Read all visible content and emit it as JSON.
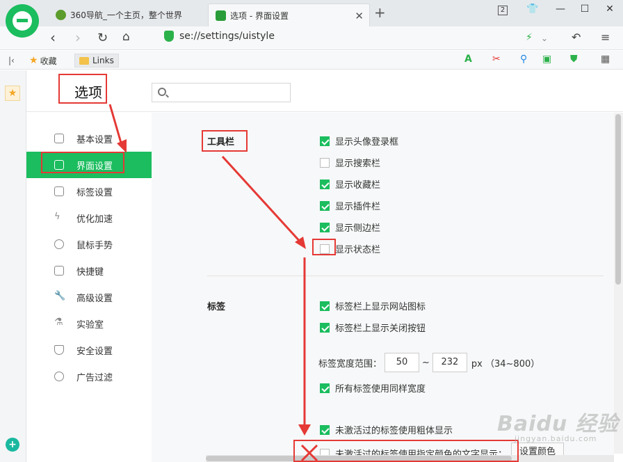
{
  "tabs": [
    {
      "label": "360导航_一个主页，整个世界"
    },
    {
      "label": "选项 - 界面设置"
    }
  ],
  "window": {
    "tab_count": "2"
  },
  "nav": {
    "url": "se://settings/uistyle"
  },
  "bookmarks": {
    "favorites_label": "收藏",
    "links_label": "Links"
  },
  "header": {
    "title": "选项",
    "search_placeholder": ""
  },
  "menu": [
    {
      "label": "基本设置"
    },
    {
      "label": "界面设置"
    },
    {
      "label": "标签设置"
    },
    {
      "label": "优化加速"
    },
    {
      "label": "鼠标手势"
    },
    {
      "label": "快捷键"
    },
    {
      "label": "高级设置"
    },
    {
      "label": "实验室"
    },
    {
      "label": "安全设置"
    },
    {
      "label": "广告过滤"
    }
  ],
  "toolbar_section": {
    "title": "工具栏",
    "options": [
      {
        "label": "显示头像登录框",
        "checked": true
      },
      {
        "label": "显示搜索栏",
        "checked": false
      },
      {
        "label": "显示收藏栏",
        "checked": true
      },
      {
        "label": "显示插件栏",
        "checked": true
      },
      {
        "label": "显示侧边栏",
        "checked": true
      },
      {
        "label": "显示状态栏",
        "checked": false
      }
    ]
  },
  "tabs_section": {
    "title": "标签",
    "options": [
      {
        "label": "标签栏上显示网站图标",
        "checked": true
      },
      {
        "label": "标签栏上显示关闭按钮",
        "checked": true
      }
    ],
    "width_range": {
      "label": "标签宽度范围：",
      "min": "50",
      "sep": "~",
      "max": "232",
      "unit": "px （34~800）"
    },
    "same_width": {
      "label": "所有标签使用同样宽度",
      "checked": true
    },
    "bold_inactive": {
      "label": "未激活过的标签使用粗体显示",
      "checked": true
    },
    "color_inactive": {
      "label": "未激活过的标签使用指定颜色的文字显示：",
      "checked": false
    },
    "color_button": "设置颜色"
  },
  "watermark": {
    "text": "Baidu 经验",
    "sub": "jingyan.baidu.com"
  }
}
